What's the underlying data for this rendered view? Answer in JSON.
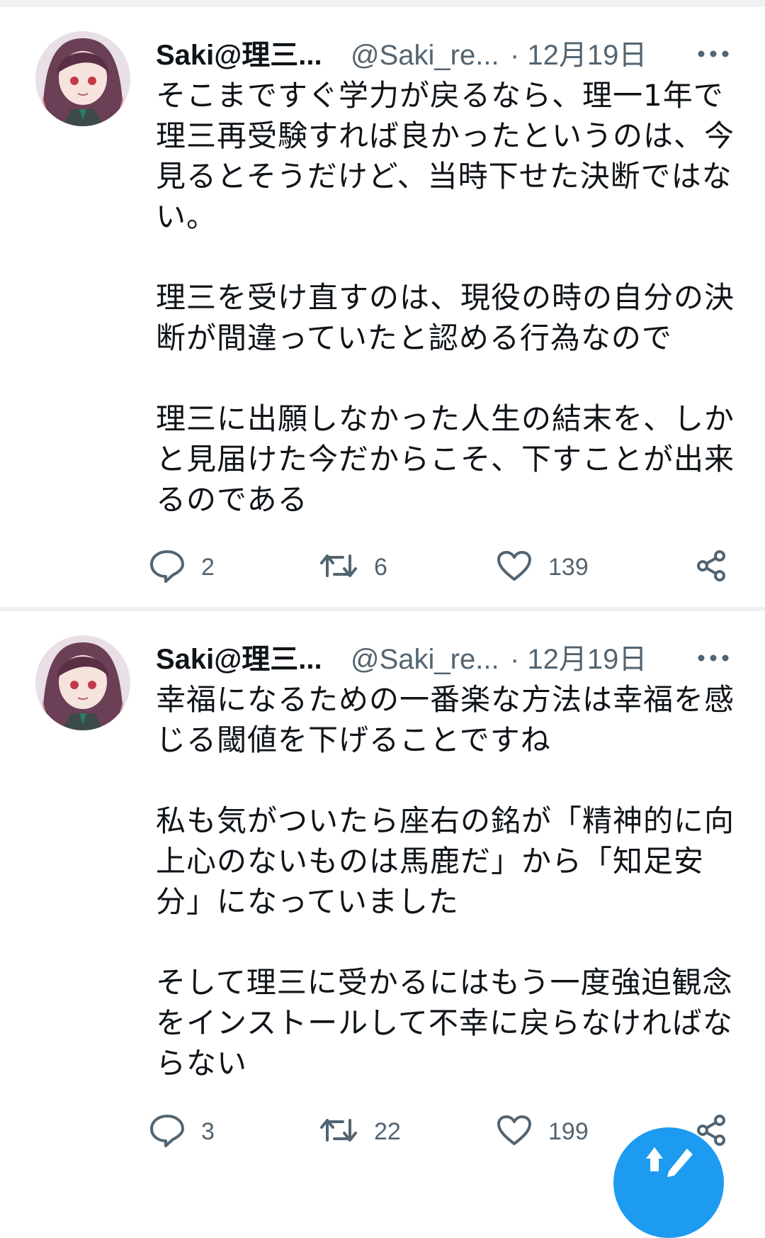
{
  "tweets": [
    {
      "display_name": "Saki@理三...",
      "handle": "@Saki_re...",
      "date": "· 12月19日",
      "text": "そこまですぐ学力が戻るなら、理一1年で理三再受験すれば良かったというのは、今見るとそうだけど、当時下せた決断ではない。\n\n理三を受け直すのは、現役の時の自分の決断が間違っていたと認める行為なので\n\n理三に出願しなかった人生の結末を、しかと見届けた今だからこそ、下すことが出来るのである",
      "reply_count": "2",
      "retweet_count": "6",
      "like_count": "139"
    },
    {
      "display_name": "Saki@理三...",
      "handle": "@Saki_re...",
      "date": "· 12月19日",
      "text": "幸福になるための一番楽な方法は幸福を感じる閾値を下げることですね\n\n私も気がついたら座右の銘が「精神的に向上心のないものは馬鹿だ」から「知足安分」になっていました\n\nそして理三に受かるにはもう一度強迫観念をインストールして不幸に戻らなければならない",
      "reply_count": "3",
      "retweet_count": "22",
      "like_count": "199"
    }
  ],
  "icons": {
    "avatar": "avatar",
    "more": "more-icon",
    "reply": "reply-icon",
    "retweet": "retweet-icon",
    "like": "like-icon",
    "share": "share-icon",
    "compose": "compose-icon"
  },
  "colors": {
    "text": "#0f1419",
    "muted": "#536471",
    "accent": "#1d9bf0",
    "divider": "#eef0f2"
  }
}
